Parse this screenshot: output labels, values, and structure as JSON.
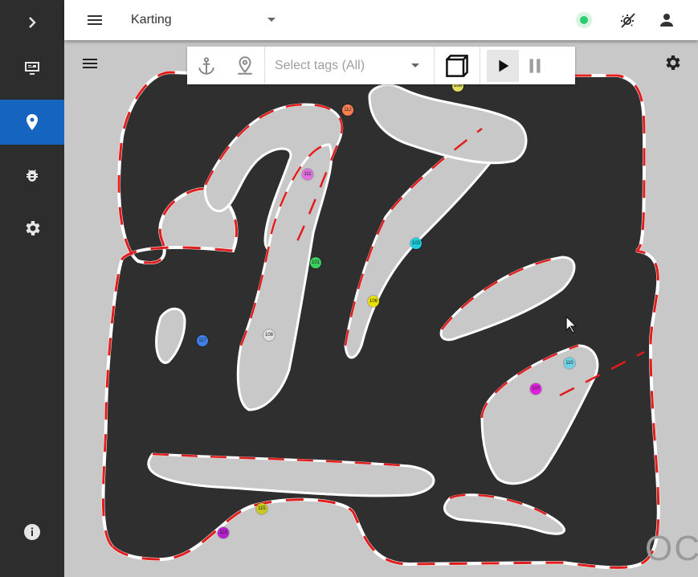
{
  "app": {
    "site_name": "Karting"
  },
  "toolbar": {
    "tags_placeholder": "Select tags (All)"
  },
  "tags": [
    {
      "label": "112",
      "color": "#ff7f50"
    },
    {
      "label": "111",
      "color": "#e070e0"
    },
    {
      "label": "101",
      "color": "#3ccf5e"
    },
    {
      "label": "103",
      "color": "#1ccfe0"
    },
    {
      "label": "106",
      "color": "#e8e000"
    },
    {
      "label": "108",
      "color": "#e0e0e0"
    },
    {
      "label": "117",
      "color": "#3f7fe8"
    },
    {
      "label": "110",
      "color": "#6fd3e6"
    },
    {
      "label": "107",
      "color": "#e01fe0"
    },
    {
      "label": "115",
      "color": "#c8c81e"
    },
    {
      "label": "113",
      "color": "#b51fd0"
    },
    {
      "label": "109",
      "color": "#e0e060"
    }
  ],
  "colors": {
    "accent": "#1565c0",
    "track": "#2f2f2f",
    "curb_red": "#e01d1d",
    "status_ok": "#2ecc71"
  }
}
